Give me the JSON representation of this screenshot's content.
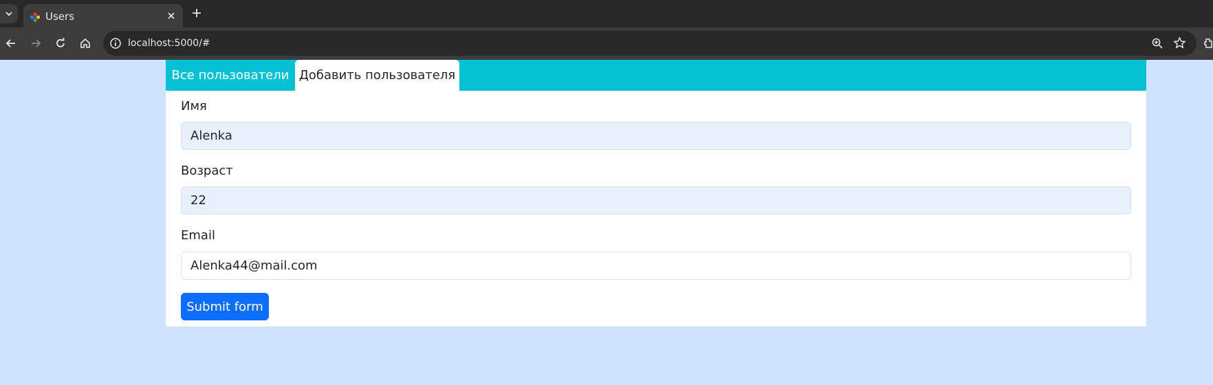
{
  "browser": {
    "tab_title": "Users",
    "url": "localhost:5000/#"
  },
  "nav": {
    "tabs": [
      {
        "label": "Все пользователи",
        "active": false
      },
      {
        "label": "Добавить пользователя",
        "active": true
      }
    ]
  },
  "form": {
    "name_label": "Имя",
    "name_value": "Alenka",
    "age_label": "Возраст",
    "age_value": "22",
    "email_label": "Email",
    "email_value": "Alenka44@mail.com",
    "submit_label": "Submit form"
  },
  "colors": {
    "page_background": "#cfe2ff",
    "nav_background": "#06c1d4",
    "primary_button": "#0d6efd",
    "autofill_background": "#e8f0fe"
  }
}
